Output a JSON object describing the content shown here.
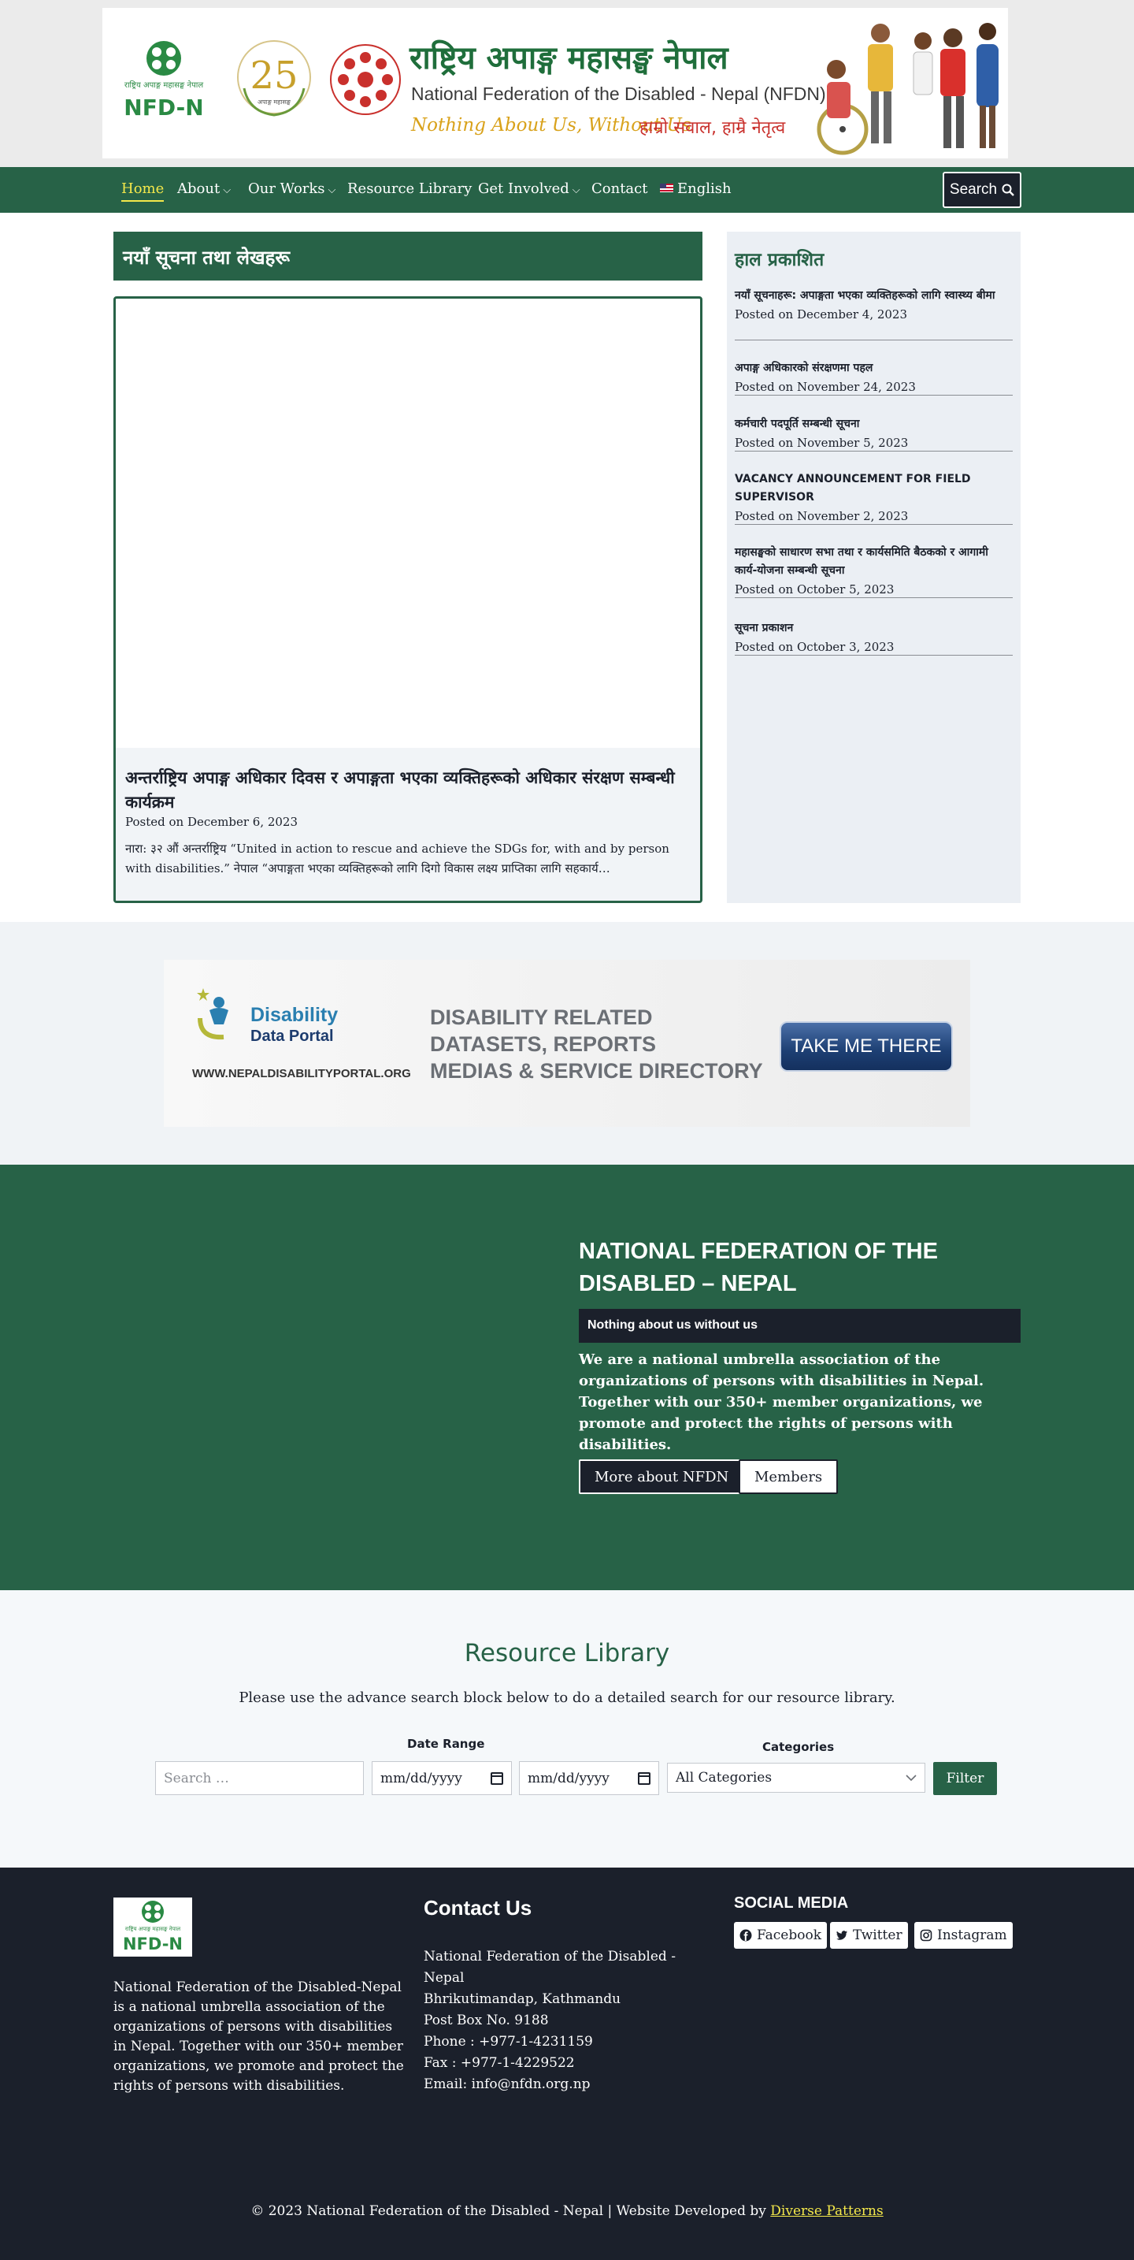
{
  "header": {
    "banner_np": "राष्ट्रिय अपाङ्ग महासङ्घ नेपाल",
    "banner_en": "National Federation of the Disabled - Nepal (NFDN)",
    "slogan_en": "Nothing About Us, Without Us",
    "slogan_np": "हाम्रो सवाल, हाम्रै नेतृत्व",
    "logo_text": "NFD-N",
    "logo_caption": "राष्ट्रिय अपाङ्ग महासङ्घ नेपाल"
  },
  "nav": {
    "items": [
      {
        "label": "Home",
        "dropdown": false
      },
      {
        "label": "About",
        "dropdown": true
      },
      {
        "label": "Our Works",
        "dropdown": true
      },
      {
        "label": "Resource Library",
        "dropdown": false
      },
      {
        "label": "Get Involved",
        "dropdown": true
      },
      {
        "label": "Contact",
        "dropdown": false
      },
      {
        "label": "English",
        "dropdown": false
      }
    ],
    "search_label": "Search"
  },
  "main": {
    "title_bar": "नयाँ सूचना तथा लेखहरू",
    "post": {
      "headline": "अन्तर्राष्ट्रिय अपाङ्ग अधिकार दिवस र अपाङ्गता भएका व्यक्तिहरूको अधिकार संरक्षण सम्बन्धी कार्यक्रम",
      "date": "Posted on December 6, 2023",
      "excerpt": "नारा: ३२ औं अन्तर्राष्ट्रिय “United in action to rescue and achieve the SDGs for, with and by person with disabilities.” नेपाल “अपाङ्गता भएका व्यक्तिहरूको लागि दिगो विकास लक्ष्य प्राप्तिका लागि सहकार्य…"
    }
  },
  "sidebar": {
    "title": "हाल प्रकाशित",
    "posts": [
      {
        "title": "नयाँ सूचनाहरू: अपाङ्गता भएका व्यक्तिहरूको लागि स्वास्थ्य बीमा",
        "date": "Posted on December 4, 2023"
      },
      {
        "title": "अपाङ्ग अधिकारको संरक्षणमा पहल",
        "date": "Posted on November 24, 2023"
      },
      {
        "title": "कर्मचारी पदपूर्ति सम्बन्धी सूचना",
        "date": "Posted on November 5, 2023"
      },
      {
        "title": "VACANCY ANNOUNCEMENT FOR FIELD SUPERVISOR",
        "date": "Posted on November 2, 2023"
      },
      {
        "title": "महासङ्घको साधारण सभा तथा र कार्यसमिति बैठकको र आगामी कार्य-योजना सम्बन्धी सूचना",
        "date": "Posted on October 5, 2023"
      },
      {
        "title": "सूचना प्रकाशन",
        "date": "Posted on October 3, 2023"
      }
    ]
  },
  "portal": {
    "name_line1": "Disability",
    "name_line2": "Data Portal",
    "url": "WWW.NEPALDISABILITYPORTAL.ORG",
    "text_line1": "DISABILITY RELATED",
    "text_line2": "DATASETS, REPORTS",
    "text_line3": "MEDIAS & SERVICE DIRECTORY",
    "button": "TAKE ME THERE"
  },
  "about": {
    "title": "NATIONAL FEDERATION OF THE DISABLED – NEPAL",
    "tagline": "Nothing about us without us",
    "text": "We are a national umbrella association of the organizations of persons with disabilities in Nepal. Together with our 350+ member organizations, we promote and protect the rights of persons with disabilities.",
    "btn_more": "More about NFDN",
    "btn_members": "Members"
  },
  "resource": {
    "title": "Resource Library",
    "subtitle": "Please use the advance search block below to do a detailed search for our resource library.",
    "date_range_label": "Date Range",
    "categories_label": "Categories",
    "search_placeholder": "Search …",
    "date_from": "mm/dd/yyyy",
    "date_to": "mm/dd/yyyy",
    "category_selected": "All Categories",
    "filter_button": "Filter"
  },
  "footer": {
    "description": "National Federation of the Disabled-Nepal is a national umbrella association of the organizations of persons with disabilities in Nepal. Together with our 350+ member organizations, we promote and protect the rights of persons with disabilities.",
    "contact_title": "Contact Us",
    "contact_lines": [
      "National Federation of the Disabled - Nepal",
      "Bhrikutimandap, Kathmandu",
      "Post Box No. 9188",
      "Phone : +977-1-4231159",
      "Fax : +977-1-4229522",
      "Email: info@nfdn.org.np"
    ],
    "social_title": "SOCIAL MEDIA",
    "social": [
      {
        "label": "Facebook",
        "icon": "facebook-icon"
      },
      {
        "label": "Twitter",
        "icon": "twitter-icon"
      },
      {
        "label": "Instagram",
        "icon": "instagram-icon"
      }
    ],
    "copyright_text": "© 2023 National Federation of the Disabled - Nepal | Website Developed by",
    "developer": "Diverse Patterns"
  },
  "colors": {
    "brand_green": "#276247",
    "dark": "#1b202b",
    "accent_yellow": "#f4e84a"
  }
}
